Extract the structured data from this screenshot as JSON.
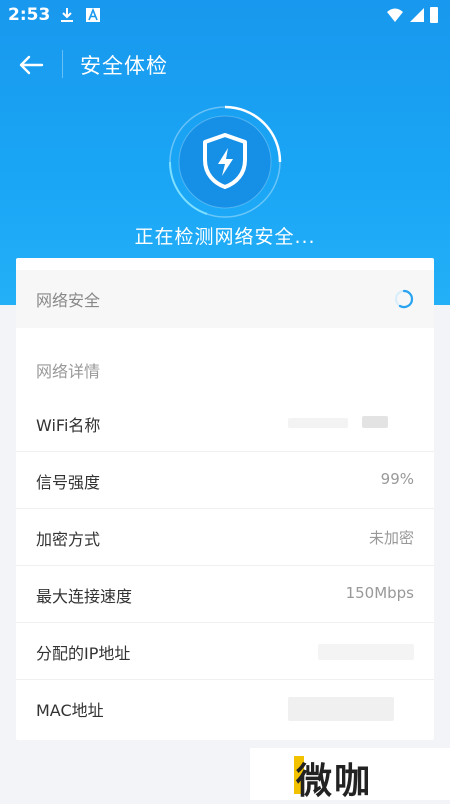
{
  "status_bar": {
    "time": "2:53"
  },
  "toolbar": {
    "title": "安全体检"
  },
  "scan": {
    "status_text": "正在检测网络安全..."
  },
  "security_row": {
    "label": "网络安全"
  },
  "details": {
    "section_title": "网络详情",
    "rows": [
      {
        "label": "WiFi名称",
        "value": ""
      },
      {
        "label": "信号强度",
        "value": "99%"
      },
      {
        "label": "加密方式",
        "value": "未加密"
      },
      {
        "label": "最大连接速度",
        "value": "150Mbps"
      },
      {
        "label": "分配的IP地址",
        "value": ""
      },
      {
        "label": "MAC地址",
        "value": ""
      }
    ]
  },
  "watermark": {
    "text": "微咖"
  },
  "colors": {
    "primary": "#1aa6f5",
    "card_bg": "#ffffff",
    "label": "#333333",
    "muted": "#999999"
  }
}
